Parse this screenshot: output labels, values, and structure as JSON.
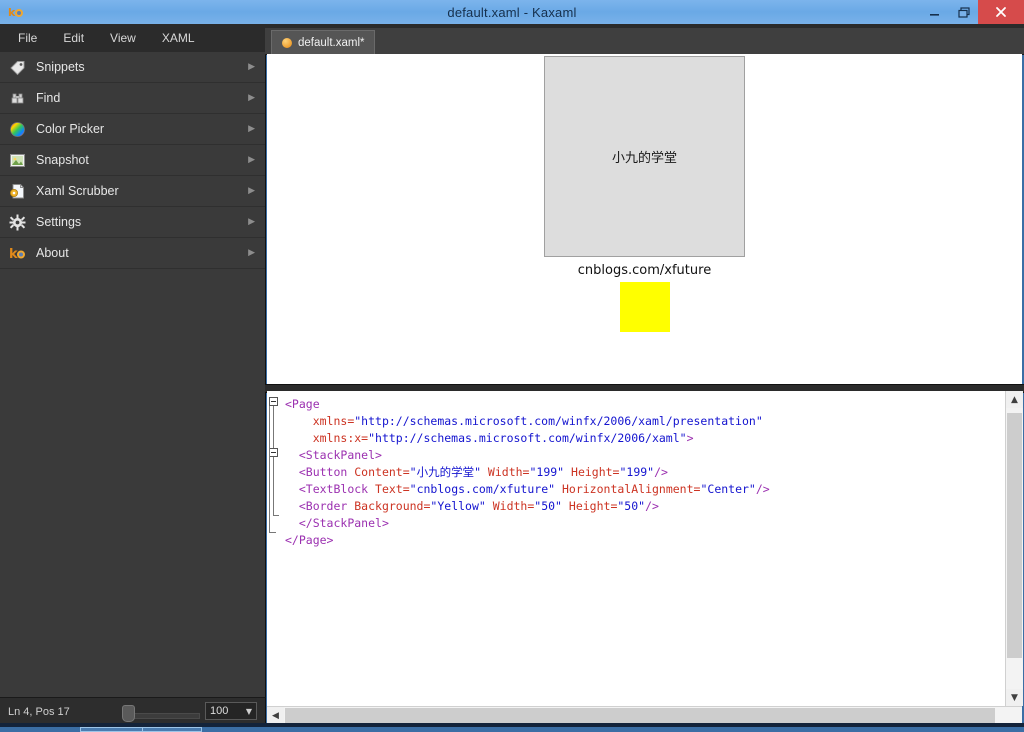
{
  "window": {
    "title": "default.xaml - Kaxaml",
    "app_icon": "kaxaml-logo-icon",
    "controls": {
      "minimize": "minimize-button",
      "restore": "restore-button",
      "close": "close-button"
    }
  },
  "menubar": {
    "items": [
      {
        "label": "File"
      },
      {
        "label": "Edit"
      },
      {
        "label": "View"
      },
      {
        "label": "XAML"
      }
    ]
  },
  "sidebar": {
    "items": [
      {
        "label": "Snippets",
        "icon": "tag-icon",
        "arrow": "▶"
      },
      {
        "label": "Find",
        "icon": "binoculars-icon",
        "arrow": "▶"
      },
      {
        "label": "Color Picker",
        "icon": "color-wheel-icon",
        "arrow": "▶"
      },
      {
        "label": "Snapshot",
        "icon": "picture-icon",
        "arrow": "▶"
      },
      {
        "label": "Xaml Scrubber",
        "icon": "document-gear-icon",
        "arrow": "▶"
      },
      {
        "label": "Settings",
        "icon": "gear-icon",
        "arrow": "▶"
      },
      {
        "label": "About",
        "icon": "kaxaml-logo-icon",
        "arrow": "▶"
      }
    ]
  },
  "statusbar": {
    "caret": "Ln 4, Pos 17",
    "zoom_value": "100",
    "zoom_caret": "▼"
  },
  "tabs": [
    {
      "label": "default.xaml*",
      "dot": "unsaved-dot-icon"
    }
  ],
  "preview": {
    "button_content": "小九的学堂",
    "button_width": "199",
    "button_height": "199",
    "textblock_text": "cnblogs.com/xfuture",
    "border_background": "Yellow",
    "border_width": "50",
    "border_height": "50",
    "border_color": "#ffff00",
    "button_background": "#dddddd"
  },
  "editor": {
    "lines": [
      [
        {
          "t": "tag",
          "s": "<Page"
        }
      ],
      [
        {
          "t": "plain",
          "s": "    "
        },
        {
          "t": "attr",
          "s": "xmlns="
        },
        {
          "t": "val",
          "s": "\"http://schemas.microsoft.com/winfx/2006/xaml/presentation\""
        }
      ],
      [
        {
          "t": "plain",
          "s": "    "
        },
        {
          "t": "attr",
          "s": "xmlns:x="
        },
        {
          "t": "val",
          "s": "\"http://schemas.microsoft.com/winfx/2006/xaml\""
        },
        {
          "t": "tag",
          "s": ">"
        }
      ],
      [
        {
          "t": "plain",
          "s": "  "
        },
        {
          "t": "tag",
          "s": "<StackPanel>"
        }
      ],
      [
        {
          "t": "plain",
          "s": "  "
        },
        {
          "t": "tag",
          "s": "<Button "
        },
        {
          "t": "attr",
          "s": "Content="
        },
        {
          "t": "val",
          "s": "\"小九的学堂\" "
        },
        {
          "t": "attr",
          "s": "Width="
        },
        {
          "t": "val",
          "s": "\"199\" "
        },
        {
          "t": "attr",
          "s": "Height="
        },
        {
          "t": "val",
          "s": "\"199\""
        },
        {
          "t": "tag",
          "s": "/>"
        }
      ],
      [
        {
          "t": "plain",
          "s": "  "
        },
        {
          "t": "tag",
          "s": "<TextBlock "
        },
        {
          "t": "attr",
          "s": "Text="
        },
        {
          "t": "val",
          "s": "\"cnblogs.com/xfuture\" "
        },
        {
          "t": "attr",
          "s": "HorizontalAlignment="
        },
        {
          "t": "val",
          "s": "\"Center\""
        },
        {
          "t": "tag",
          "s": "/>"
        }
      ],
      [
        {
          "t": "plain",
          "s": "  "
        },
        {
          "t": "tag",
          "s": "<Border "
        },
        {
          "t": "attr",
          "s": "Background="
        },
        {
          "t": "val",
          "s": "\"Yellow\" "
        },
        {
          "t": "attr",
          "s": "Width="
        },
        {
          "t": "val",
          "s": "\"50\" "
        },
        {
          "t": "attr",
          "s": "Height="
        },
        {
          "t": "val",
          "s": "\"50\""
        },
        {
          "t": "tag",
          "s": "/>"
        }
      ],
      [
        {
          "t": "plain",
          "s": "  "
        },
        {
          "t": "tag",
          "s": "</StackPanel>"
        }
      ],
      [
        {
          "t": "tag",
          "s": "</Page>"
        }
      ]
    ]
  },
  "scrollbars": {
    "v_up": "▲",
    "v_down": "▼",
    "h_left": "◀"
  },
  "colors": {
    "titlebar": "#6aa9e6",
    "chrome_dark": "#3a3a3a",
    "accent_close": "#d64b4b",
    "tag": "#9b30b0",
    "attr": "#cc3322",
    "value": "#1414cf"
  }
}
